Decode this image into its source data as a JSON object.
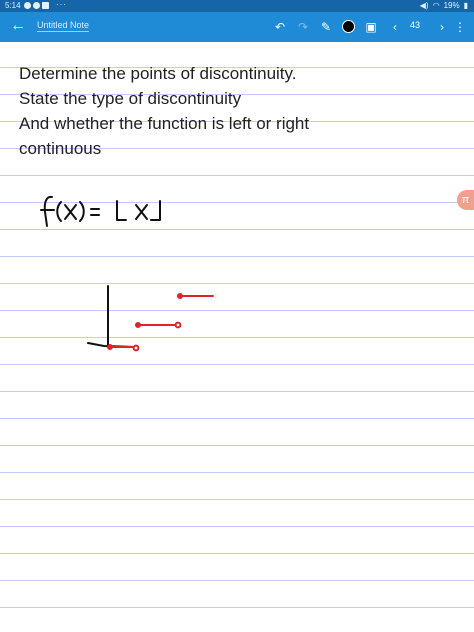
{
  "status": {
    "time": "5:14",
    "more": "···",
    "battery": "19%"
  },
  "app": {
    "title": "Untitled Note",
    "page_number": "43"
  },
  "note": {
    "lines": [
      "Determine the points of discontinuity.",
      "State the type of discontinuity",
      "And whether the function is left or right",
      "continuous"
    ],
    "handwriting": "f(x) = ⌊x⌋"
  },
  "colors": {
    "toolbar": "#1f8bd6",
    "statusbar": "#1565a8",
    "ruling": "#c7cdf2",
    "ink": "#111111",
    "red_ink": "#d9262b"
  }
}
